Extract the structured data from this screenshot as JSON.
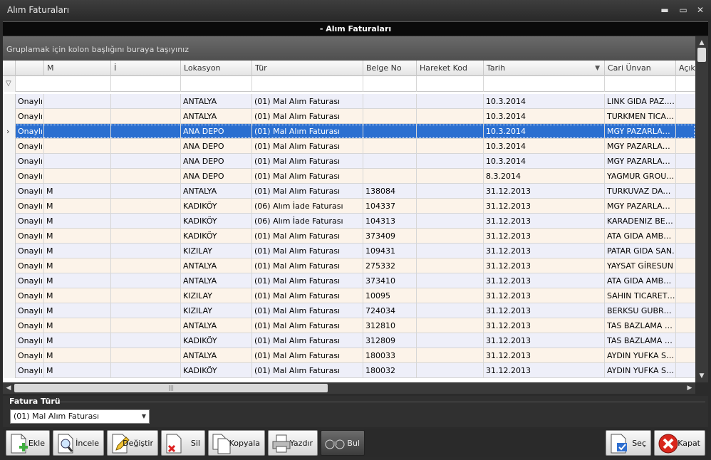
{
  "window": {
    "title": "Alım Faturaları",
    "min": "▬",
    "max": "▭",
    "close": "✕"
  },
  "form_header": "- Alım Faturaları",
  "group_panel_text": "Gruplamak için kolon başlığını buraya taşıyınız",
  "columns": [
    "M",
    "İ",
    "Lokasyon",
    "Tür",
    "Belge No",
    "Hareket Kod",
    "Tarih",
    "Cari Ünvan",
    "Açıkl"
  ],
  "sort_indicator": "▼",
  "rows": [
    [
      "Onaylı",
      "",
      "",
      "ANTALYA",
      "(01) Mal Alım Faturası",
      "",
      "",
      "10.3.2014",
      "LINK GIDA PAZ.SAN.VE TIC"
    ],
    [
      "Onaylı",
      "",
      "",
      "ANTALYA",
      "(01) Mal Alım Faturası",
      "",
      "",
      "10.3.2014",
      "TURKMEN TICARET LTD"
    ],
    [
      "Onaylı",
      "",
      "",
      "ANA DEPO",
      "(01) Mal Alım Faturası",
      "",
      "",
      "10.3.2014",
      "MGY PAZARLAM A.Ş."
    ],
    [
      "Onaylı",
      "",
      "",
      "ANA DEPO",
      "(01) Mal Alım Faturası",
      "",
      "",
      "10.3.2014",
      "MGY PAZARLAM A.Ş."
    ],
    [
      "Onaylı",
      "",
      "",
      "ANA DEPO",
      "(01) Mal Alım Faturası",
      "",
      "",
      "10.3.2014",
      "MGY PAZARLAM A.Ş."
    ],
    [
      "Onaylı",
      "",
      "",
      "ANA DEPO",
      "(01) Mal Alım Faturası",
      "",
      "",
      "8.3.2014",
      "YAGMUR GROUP LTD"
    ],
    [
      "Onaylı",
      "M",
      "",
      "ANTALYA",
      "(01) Mal Alım Faturası",
      "138084",
      "",
      "31.12.2013",
      "TURKUVAZ DAĞITIM"
    ],
    [
      "Onaylı",
      "M",
      "",
      "KADIKÖY",
      "(06) Alım İade Faturası",
      "104337",
      "",
      "31.12.2013",
      "MGY PAZARLAM A.Ş."
    ],
    [
      "Onaylı",
      "M",
      "",
      "KADIKÖY",
      "(06) Alım İade Faturası",
      "104313",
      "",
      "31.12.2013",
      "KARADENIZ BEY LTD"
    ],
    [
      "Onaylı",
      "M",
      "",
      "KADIKÖY",
      "(01) Mal Alım Faturası",
      "373409",
      "",
      "31.12.2013",
      "ATA GIDA AMBALAJ"
    ],
    [
      "Onaylı",
      "M",
      "",
      "KIZILAY",
      "(01) Mal Alım Faturası",
      "109431",
      "",
      "31.12.2013",
      "PATAR GIDA SAN."
    ],
    [
      "Onaylı",
      "M",
      "",
      "ANTALYA",
      "(01) Mal Alım Faturası",
      "275332",
      "",
      "31.12.2013",
      "YAYSAT GİRESUN"
    ],
    [
      "Onaylı",
      "M",
      "",
      "ANTALYA",
      "(01) Mal Alım Faturası",
      "373410",
      "",
      "31.12.2013",
      "ATA GIDA AMBALAJ"
    ],
    [
      "Onaylı",
      "M",
      "",
      "KIZILAY",
      "(01) Mal Alım Faturası",
      "10095",
      "",
      "31.12.2013",
      "SAHIN TICARET LTD"
    ],
    [
      "Onaylı",
      "M",
      "",
      "KIZILAY",
      "(01) Mal Alım Faturası",
      "724034",
      "",
      "31.12.2013",
      "BERKSU GUBRE LTD"
    ],
    [
      "Onaylı",
      "M",
      "",
      "ANTALYA",
      "(01) Mal Alım Faturası",
      "312810",
      "",
      "31.12.2013",
      "TAS BAZLAMA GIDA"
    ],
    [
      "Onaylı",
      "M",
      "",
      "KADIKÖY",
      "(01) Mal Alım Faturası",
      "312809",
      "",
      "31.12.2013",
      "TAS BAZLAMA GIDA"
    ],
    [
      "Onaylı",
      "M",
      "",
      "ANTALYA",
      "(01) Mal Alım Faturası",
      "180033",
      "",
      "31.12.2013",
      "AYDIN YUFKA SAN."
    ],
    [
      "Onaylı",
      "M",
      "",
      "KADIKÖY",
      "(01) Mal Alım Faturası",
      "180032",
      "",
      "31.12.2013",
      "AYDIN YUFKA SAN."
    ]
  ],
  "selected_row": 2,
  "fatura_turu": {
    "legend": "Fatura Türü",
    "value": "(01) Mal Alım Faturası"
  },
  "toolbar": {
    "ekle": "Ekle",
    "incele": "İncele",
    "degistir": "Değiştir",
    "sil": "Sil",
    "kopyala": "Kopyala",
    "yazdir": "Yazdır",
    "bul": "Bul",
    "sec": "Seç",
    "kapat": "Kapat"
  }
}
